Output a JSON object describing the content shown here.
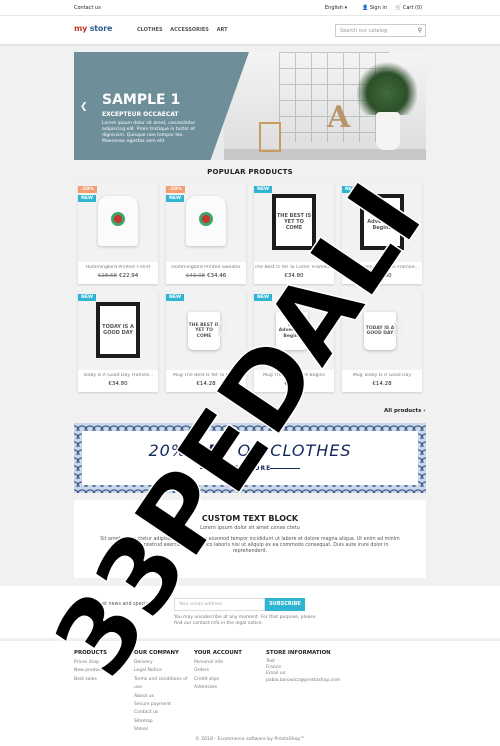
{
  "topbar": {
    "contact": "Contact us",
    "language": "English ▾",
    "sign_in": "Sign in",
    "cart": "Cart (0)"
  },
  "header": {
    "logo": {
      "mark": "my",
      "rest": " store"
    },
    "nav": [
      "CLOTHES",
      "ACCESSORIES",
      "ART"
    ],
    "search_placeholder": "Search our catalog"
  },
  "slider": {
    "title": "SAMPLE 1",
    "subtitle": "EXCEPTEUR OCCAECAT",
    "text": "Lorem ipsum dolor sit amet, consectetur adipiscing elit. Proin tristique in tortor et dignissim. Quisque non tempor leo. Maecenas egestas sem elit",
    "letter": "A"
  },
  "popular": {
    "title": "POPULAR PRODUCTS",
    "products": [
      {
        "name": "Hummingbird Printed T-shirt",
        "old_price": "€28.68",
        "price": "€22.94",
        "discount": "-20%",
        "new": "NEW",
        "art": "tshirt",
        "art_text": ""
      },
      {
        "name": "Hummingbird Printed Sweater",
        "old_price": "€43.08",
        "price": "€34.46",
        "discount": "-20%",
        "new": "NEW",
        "art": "tshirt",
        "art_text": ""
      },
      {
        "name": "The Best Is Yet To Come' Framed...",
        "old_price": "",
        "price": "€34.80",
        "discount": "",
        "new": "NEW",
        "art": "frame",
        "art_text": "THE BEST IS YET TO COME"
      },
      {
        "name": "The Adventure Begins Framed...",
        "old_price": "",
        "price": "€34.80",
        "discount": "",
        "new": "NEW",
        "art": "frame",
        "art_text": "The Adventure Begins"
      },
      {
        "name": "Today Is A Good Day Framed...",
        "old_price": "",
        "price": "€34.80",
        "discount": "",
        "new": "NEW",
        "art": "frame",
        "art_text": "TODAY IS A GOOD DAY"
      },
      {
        "name": "Mug The Best Is Yet To Come",
        "old_price": "",
        "price": "€14.28",
        "discount": "",
        "new": "NEW",
        "art": "mug",
        "art_text": "THE BEST IS YET TO COME"
      },
      {
        "name": "Mug The Adventure Begins",
        "old_price": "",
        "price": "€14.28",
        "discount": "",
        "new": "NEW",
        "art": "mug",
        "art_text": "The Adventure Begins"
      },
      {
        "name": "Mug Today Is A Good Day",
        "old_price": "",
        "price": "€14.28",
        "discount": "",
        "new": "",
        "art": "mug",
        "art_text": "TODAY IS A GOOD DAY"
      }
    ],
    "all_products": "All products ›"
  },
  "banner": {
    "text_a": "20% ",
    "text_b": "OFF",
    "text_c": " ON CLOTHES",
    "more": "SEE MORE"
  },
  "custom_block": {
    "title": "CUSTOM TEXT BLOCK",
    "subtitle": "Lorem ipsum dolor sit amet conse ctetu",
    "text": "Sit amet conse ctetur adipisicing elit, sed do eiusmod tempor incididunt ut labore et dolore magna aliqua. Ut enim ad minim veniam, quis nostrud exercitation ullamco laboris nisi ut aliquip ex ea commodo consequat. Duis aute irure dolor in reprehenderit."
  },
  "newsletter": {
    "label": "Get our latest news and special sales",
    "placeholder": "Your email address",
    "button": "SUBSCRIBE",
    "note": "You may unsubscribe at any moment. For that purpose, please find our contact info in the legal notice."
  },
  "footer": {
    "products": {
      "title": "PRODUCTS",
      "links": [
        "Prices drop",
        "New products",
        "Best sales"
      ]
    },
    "company": {
      "title": "OUR COMPANY",
      "links": [
        "Delivery",
        "Legal Notice",
        "Terms and conditions of",
        "use",
        "About us",
        "Secure payment",
        "Contact us",
        "Sitemap",
        "Stores"
      ]
    },
    "account": {
      "title": "YOUR ACCOUNT",
      "links": [
        "Personal info",
        "Orders",
        "Credit slips",
        "Addresses"
      ]
    },
    "store": {
      "title": "STORE INFORMATION",
      "lines": [
        "Test",
        "France",
        "Email us:",
        "pablo.borowicz@prestashop.com"
      ]
    },
    "copyright": "© 2018 - Ecommerce software by PrestaShop™"
  },
  "watermark": "33PEDALI",
  "colors": {
    "accent": "#2fb5d2",
    "discount": "#f39d72",
    "banner_navy": "#15265a",
    "slider_panel": "#6e8f9a"
  }
}
